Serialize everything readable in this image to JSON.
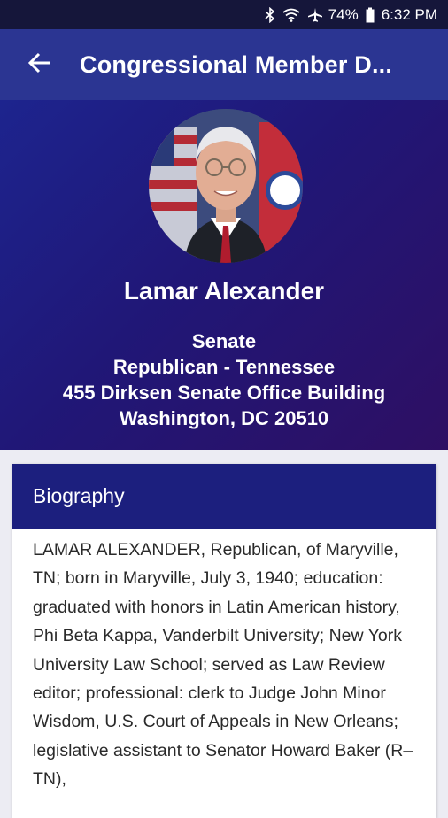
{
  "status_bar": {
    "icons": [
      "bluetooth-icon",
      "wifi-icon",
      "airplane-icon",
      "battery-icon"
    ],
    "battery": "74%",
    "time": "6:32 PM"
  },
  "app_bar": {
    "title": "Congressional Member D...",
    "back_icon": "arrow-left-icon"
  },
  "member": {
    "name": "Lamar Alexander",
    "chamber": "Senate",
    "party_state": "Republican - Tennessee",
    "address_line1": "455 Dirksen Senate Office Building",
    "address_line2": "Washington, DC 20510"
  },
  "biography": {
    "heading": "Biography",
    "text": "LAMAR ALEXANDER, Republican, of Maryville, TN; born in Maryville, July 3, 1940; education: graduated with honors in Latin American history, Phi Beta Kappa, Vanderbilt University; New York University Law School; served as Law Review editor; professional: clerk to Judge John Minor Wisdom, U.S. Court of Appeals in New Orleans; legislative assistant to Senator Howard Baker (R–TN),"
  },
  "colors": {
    "status_bar": "#15163a",
    "app_bar": "#2b3592",
    "hero_start": "#1d248e",
    "hero_end": "#2e0f63",
    "bio_header": "#1c1f7e"
  }
}
